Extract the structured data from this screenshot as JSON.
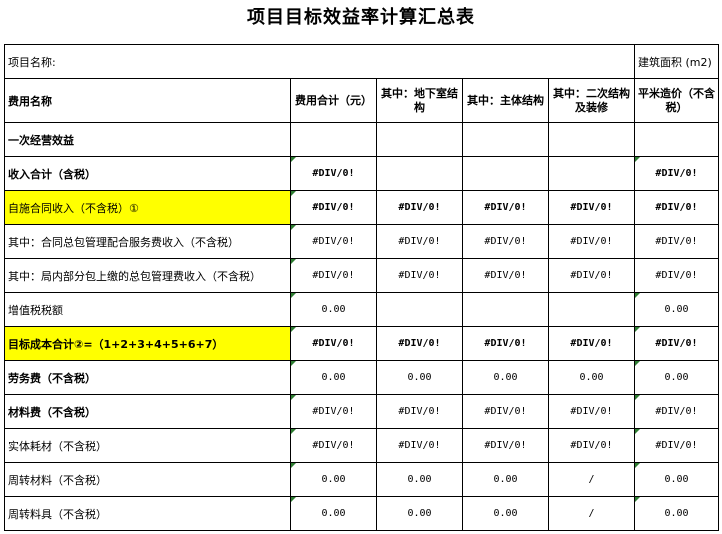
{
  "title": "项目目标效益率计算汇总表",
  "info": {
    "project_name_label": "项目名称:",
    "area_label": "建筑面积 (m2)"
  },
  "headers": {
    "name": "费用名称",
    "total": "费用合计（元）",
    "basement": "其中：地下室结构",
    "main": "其中：主体结构",
    "secondary": "其中：二次结构及装修",
    "per_sqm": "平米造价（不含税）"
  },
  "rows": [
    {
      "label": "一次经营效益",
      "v": [
        "",
        "",
        "",
        "",
        ""
      ]
    },
    {
      "label": "收入合计（含税）",
      "v": [
        "#DIV/0!",
        "",
        "",
        "",
        "#DIV/0!"
      ]
    },
    {
      "label": "自施合同收入（不含税）①",
      "v": [
        "#DIV/0!",
        "#DIV/0!",
        "#DIV/0!",
        "#DIV/0!",
        "#DIV/0!"
      ]
    },
    {
      "label": "其中：合同总包管理配合服务费收入（不含税）",
      "v": [
        "#DIV/0!",
        "#DIV/0!",
        "#DIV/0!",
        "#DIV/0!",
        "#DIV/0!"
      ]
    },
    {
      "label": "其中：局内部分包上缴的总包管理费收入（不含税）",
      "v": [
        "#DIV/0!",
        "#DIV/0!",
        "#DIV/0!",
        "#DIV/0!",
        "#DIV/0!"
      ]
    },
    {
      "label": "增值税税额",
      "v": [
        "0.00",
        "",
        "",
        "",
        "0.00"
      ]
    },
    {
      "label": "目标成本合计②=（1+2+3+4+5+6+7）",
      "v": [
        "#DIV/0!",
        "#DIV/0!",
        "#DIV/0!",
        "#DIV/0!",
        "#DIV/0!"
      ]
    },
    {
      "label": "劳务费（不含税）",
      "v": [
        "0.00",
        "0.00",
        "0.00",
        "0.00",
        "0.00"
      ]
    },
    {
      "label": "材料费（不含税）",
      "v": [
        "#DIV/0!",
        "#DIV/0!",
        "#DIV/0!",
        "#DIV/0!",
        "#DIV/0!"
      ]
    },
    {
      "label": "实体耗材（不含税）",
      "v": [
        "#DIV/0!",
        "#DIV/0!",
        "#DIV/0!",
        "#DIV/0!",
        "#DIV/0!"
      ]
    },
    {
      "label": "周转材料（不含税）",
      "v": [
        "0.00",
        "0.00",
        "0.00",
        "/",
        "0.00"
      ]
    },
    {
      "label": "周转料具（不含税）",
      "v": [
        "0.00",
        "0.00",
        "0.00",
        "/",
        "0.00"
      ]
    }
  ]
}
